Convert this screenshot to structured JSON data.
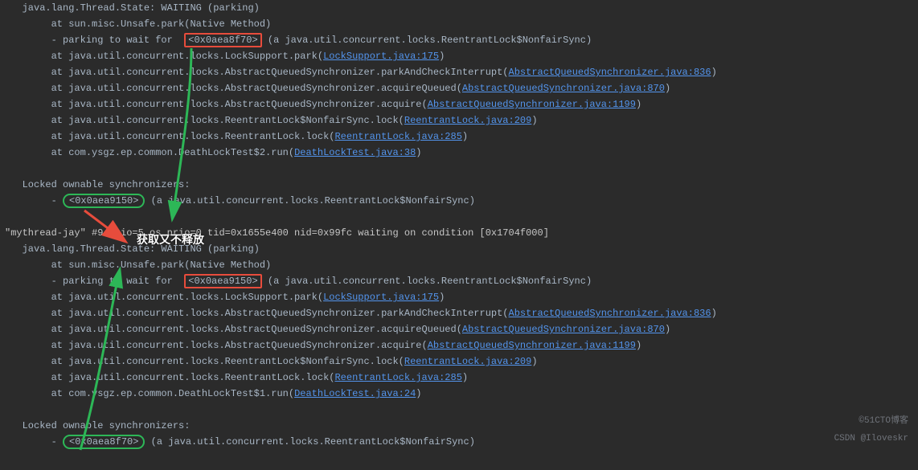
{
  "thread1": {
    "state": "   java.lang.Thread.State: WAITING (parking)",
    "l1": "        at sun.misc.Unsafe.park(Native Method)",
    "park_pre": "        - parking to wait for  ",
    "park_id": "<0x0aea8f70>",
    "park_post": " (a java.util.concurrent.locks.ReentrantLock$NonfairSync)",
    "l3": "        at java.util.concurrent.locks.LockSupport.park(",
    "l3a": "LockSupport.java:175",
    "l4": "        at java.util.concurrent.locks.AbstractQueuedSynchronizer.parkAndCheckInterrupt(",
    "l4a": "AbstractQueuedSynchronizer.java:836",
    "l5": "        at java.util.concurrent.locks.AbstractQueuedSynchronizer.acquireQueued(",
    "l5a": "AbstractQueuedSynchronizer.java:870",
    "l6": "        at java.util.concurrent.locks.AbstractQueuedSynchronizer.acquire(",
    "l6a": "AbstractQueuedSynchronizer.java:1199",
    "l7": "        at java.util.concurrent.locks.ReentrantLock$NonfairSync.lock(",
    "l7a": "ReentrantLock.java:209",
    "l8": "        at java.util.concurrent.locks.ReentrantLock.lock(",
    "l8a": "ReentrantLock.java:285",
    "l9": "        at com.ysgz.ep.common.DeathLockTest$2.run(",
    "l9a": "DeathLockTest.java:38",
    "lockedHdr": "   Locked ownable synchronizers:",
    "locked_pre": "        - ",
    "locked_id": "<0x0aea9150>",
    "locked_post": " (a java.util.concurrent.locks.ReentrantLock$NonfairSync)"
  },
  "thread2": {
    "hdr": "\"mythread-jay\" #9 prio=5 os_prio=0 tid=0x1655e400 nid=0x99fc waiting on condition [0x1704f000]",
    "state": "   java.lang.Thread.State: WAITING (parking)",
    "l1": "        at sun.misc.Unsafe.park(Native Method)",
    "park_pre": "        - parking to wait for  ",
    "park_id": "<0x0aea9150>",
    "park_post": " (a java.util.concurrent.locks.ReentrantLock$NonfairSync)",
    "l3": "        at java.util.concurrent.locks.LockSupport.park(",
    "l3a": "LockSupport.java:175",
    "l4": "        at java.util.concurrent.locks.AbstractQueuedSynchronizer.parkAndCheckInterrupt(",
    "l4a": "AbstractQueuedSynchronizer.java:836",
    "l5": "        at java.util.concurrent.locks.AbstractQueuedSynchronizer.acquireQueued(",
    "l5a": "AbstractQueuedSynchronizer.java:870",
    "l6": "        at java.util.concurrent.locks.AbstractQueuedSynchronizer.acquire(",
    "l6a": "AbstractQueuedSynchronizer.java:1199",
    "l7": "        at java.util.concurrent.locks.ReentrantLock$NonfairSync.lock(",
    "l7a": "ReentrantLock.java:209",
    "l8": "        at java.util.concurrent.locks.ReentrantLock.lock(",
    "l8a": "ReentrantLock.java:285",
    "l9": "        at com.ysgz.ep.common.DeathLockTest$1.run(",
    "l9a": "DeathLockTest.java:24",
    "lockedHdr": "   Locked ownable synchronizers:",
    "locked_pre": "        - ",
    "locked_id": "<0x0aea8f70>",
    "locked_post": " (a java.util.concurrent.locks.ReentrantLock$NonfairSync)"
  },
  "annot": {
    "text": "获取又不释放"
  },
  "credits": {
    "csdn": "CSDN @Iloveskr",
    "cto": "©51CTO博客"
  },
  "close_paren": ")"
}
